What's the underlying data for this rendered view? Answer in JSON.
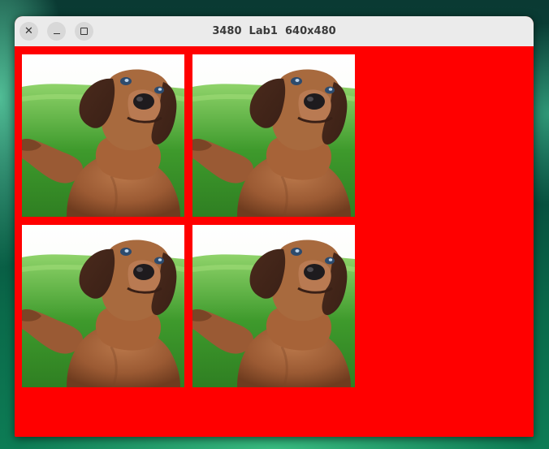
{
  "window": {
    "title": "3480  Lab1  640x480",
    "background_color": "#ff0000"
  },
  "controls": [
    {
      "name": "close-icon",
      "glyph": "✕"
    },
    {
      "name": "minimize-icon",
      "glyph": ""
    },
    {
      "name": "maximize-icon",
      "glyph": ""
    }
  ],
  "images": [
    {
      "subject": "dachshund-selfie"
    },
    {
      "subject": "dachshund-selfie"
    },
    {
      "subject": "dachshund-selfie"
    },
    {
      "subject": "dachshund-selfie"
    }
  ]
}
